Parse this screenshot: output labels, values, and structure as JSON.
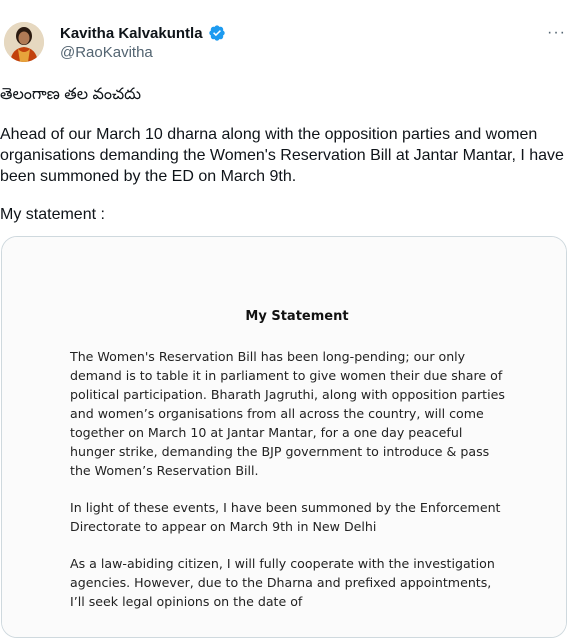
{
  "author": {
    "name": "Kavitha Kalvakuntla",
    "handle": "@RaoKavitha",
    "verified": true,
    "verified_color": "#1d9bf0"
  },
  "menu_icon": "more-horizontal-icon",
  "tweet": {
    "line1": "తెలంగాణ తల వంచదు",
    "line2": "Ahead of our March 10 dharna along with the opposition parties and women organisations demanding the Women's Reservation Bill at Jantar Mantar, I have been summoned by the ED on March 9th.",
    "line3": "My statement :"
  },
  "statement": {
    "title": "My Statement",
    "paragraphs": [
      "The Women's Reservation Bill has been long-pending; our only demand is to table it in parliament to give women their due share of political participation. Bharath Jagruthi, along with opposition parties and women’s organisations from all across the country, will come together on March 10 at Jantar Mantar, for a one day peaceful hunger strike, demanding the BJP government to introduce & pass the Women’s Reservation Bill.",
      "In light of these events, I have been summoned by the Enforcement Directorate to appear on March 9th in New Delhi",
      "As a law-abiding citizen, I will fully cooperate with the investigation agencies. However, due to the Dharna and prefixed appointments, I’ll seek legal opinions on the date of"
    ]
  }
}
